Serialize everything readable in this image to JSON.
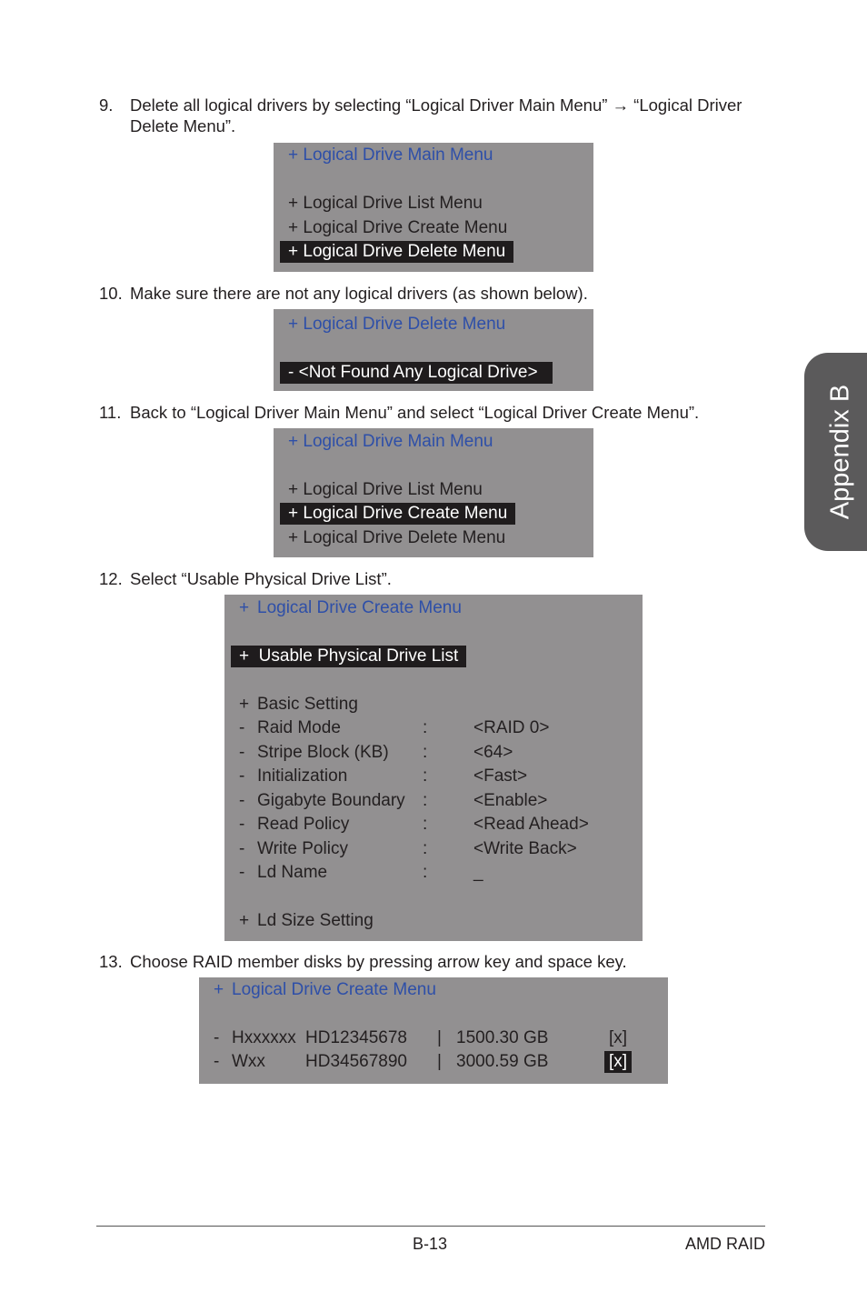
{
  "steps": [
    {
      "num": "9.",
      "text": "Delete all logical drivers by selecting “Logical Driver Main Menu” → “Logical Driver",
      "text2": "Delete Menu”."
    },
    {
      "num": "10.",
      "text": "Make sure there are not any logical drivers (as shown below)."
    },
    {
      "num": "11.",
      "text": "Back to “Logical Driver Main Menu” and select “Logical Driver Create Menu”."
    },
    {
      "num": "12.",
      "text": "Select “Usable Physical Drive List”."
    },
    {
      "num": "13.",
      "text": "Choose RAID member disks by pressing arrow key and space key."
    }
  ],
  "screen1": {
    "title": "+ Logical Drive Main Menu",
    "items": [
      "+ Logical Drive List Menu",
      "+ Logical Drive Create Menu",
      "+ Logical Drive Delete Menu"
    ]
  },
  "screen2": {
    "title": "+ Logical Drive Delete Menu",
    "item": "- <Not Found Any Logical Drive>"
  },
  "screen3": {
    "title": "+ Logical Drive Main Menu",
    "items": [
      "+ Logical Drive List Menu",
      "+ Logical Drive Create Menu",
      "+ Logical Drive Delete Menu"
    ]
  },
  "screen4": {
    "title_mark": "+",
    "title": "Logical Drive Create Menu",
    "usable_mark": "+",
    "usable": "Usable Physical Drive List",
    "basic_mark": "+",
    "basic": "Basic Setting",
    "settings": [
      {
        "mark": "-",
        "label": "Raid Mode",
        "sep": ":",
        "value": "<RAID 0>"
      },
      {
        "mark": "-",
        "label": "Stripe Block (KB)",
        "sep": ":",
        "value": "<64>"
      },
      {
        "mark": "-",
        "label": "Initialization",
        "sep": ":",
        "value": "<Fast>"
      },
      {
        "mark": "-",
        "label": "Gigabyte Boundary",
        "sep": ":",
        "value": "<Enable>"
      },
      {
        "mark": "-",
        "label": "Read Policy",
        "sep": ":",
        "value": "<Read Ahead>"
      },
      {
        "mark": "-",
        "label": "Write Policy",
        "sep": ":",
        "value": "<Write Back>"
      },
      {
        "mark": "-",
        "label": "Ld Name",
        "sep": ":",
        "value": "_"
      }
    ],
    "size_mark": "+",
    "size": "Ld Size Setting"
  },
  "screen5": {
    "title_mark": "+",
    "title": "Logical Drive Create Menu",
    "disks": [
      {
        "mark": "-",
        "vendor": "Hxxxxxx",
        "model": "HD12345678",
        "sep": "|",
        "capacity": "1500.30 GB",
        "check": "[x]"
      },
      {
        "mark": "-",
        "vendor": "Wxx",
        "model": "HD34567890",
        "sep": "|",
        "capacity": "3000.59 GB",
        "check": "[x]"
      }
    ]
  },
  "tab": "Appendix B",
  "footer": {
    "page": "B-13",
    "section": "AMD RAID"
  },
  "colors": {
    "screen_bg": "#929091",
    "title_blue": "#2e4fa8",
    "highlight": "#1f1c1d",
    "tab_bg": "#5b5a5b"
  }
}
